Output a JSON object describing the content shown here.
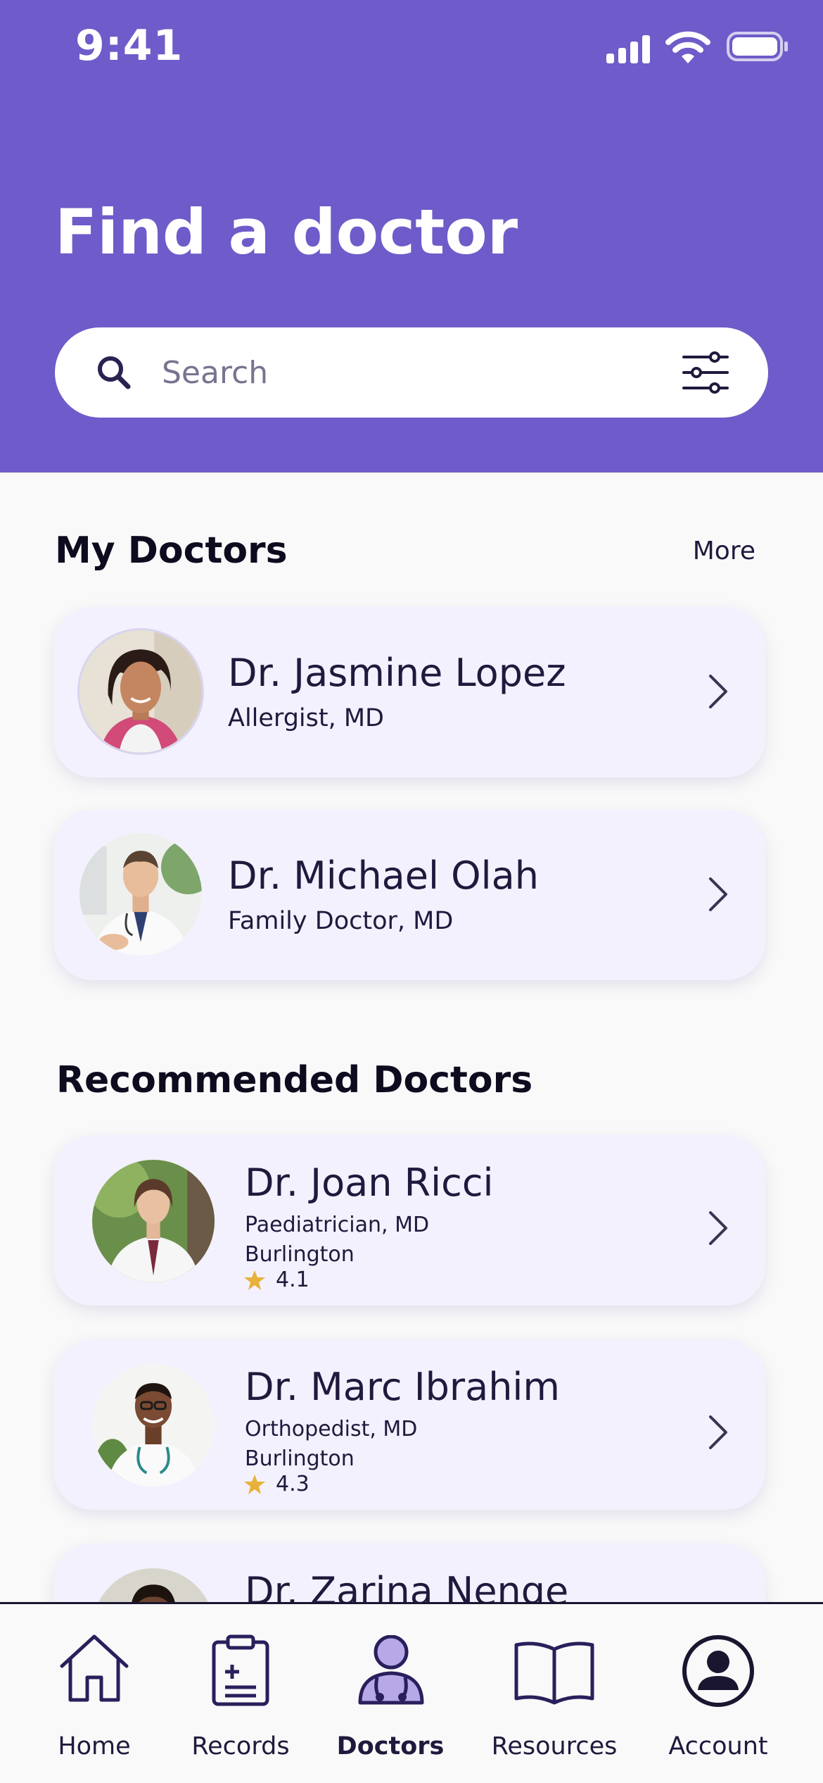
{
  "status_bar": {
    "time": "9:41"
  },
  "header": {
    "title": "Find a doctor",
    "search_placeholder": "Search"
  },
  "my_doctors": {
    "title": "My Doctors",
    "more_label": "More",
    "doctors": [
      {
        "name": "Dr. Jasmine Lopez",
        "specialty": "Allergist, MD"
      },
      {
        "name": "Dr. Michael Olah",
        "specialty": "Family Doctor, MD"
      }
    ]
  },
  "recommended": {
    "title": "Recommended Doctors",
    "doctors": [
      {
        "name": "Dr. Joan Ricci",
        "specialty": "Paediatrician, MD",
        "location": "Burlington",
        "rating": "4.1"
      },
      {
        "name": "Dr. Marc Ibrahim",
        "specialty": "Orthopedist, MD",
        "location": "Burlington",
        "rating": "4.3"
      },
      {
        "name": "Dr. Zarina Nenge"
      }
    ]
  },
  "tabs": [
    {
      "label": "Home",
      "icon": "home-icon"
    },
    {
      "label": "Records",
      "icon": "clipboard-icon"
    },
    {
      "label": "Doctors",
      "icon": "doctor-icon",
      "active": true
    },
    {
      "label": "Resources",
      "icon": "book-icon"
    },
    {
      "label": "Account",
      "icon": "account-icon"
    }
  ],
  "colors": {
    "header_bg": "#6f5bc9",
    "card_bg": "#f3f1fd",
    "text_dark": "#1f1a3d",
    "active_tab_accent": "#b7a9e8",
    "star": "#e8b13a"
  }
}
